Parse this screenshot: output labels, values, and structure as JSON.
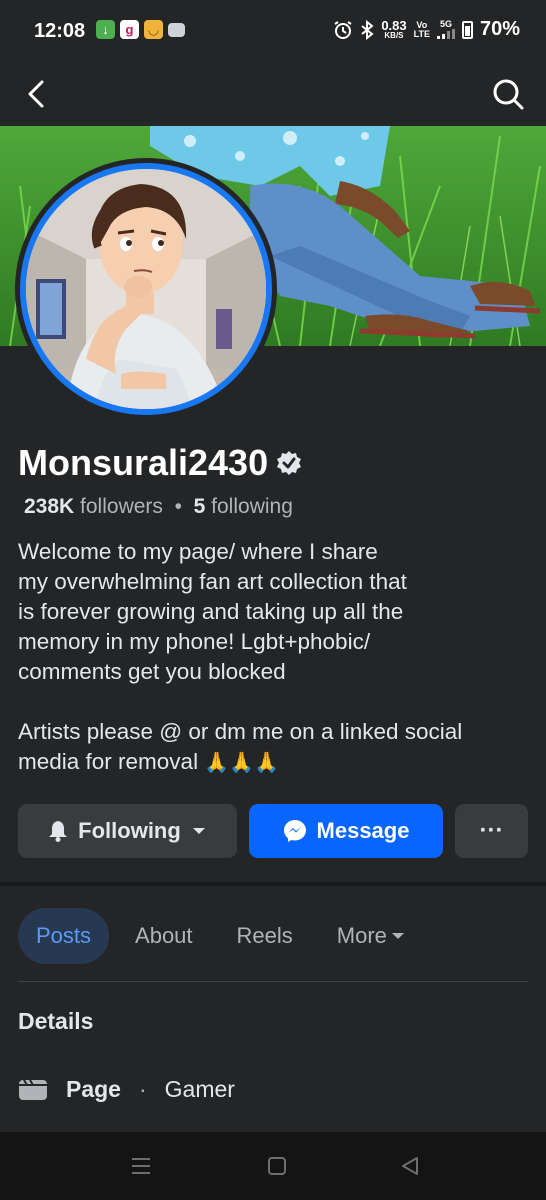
{
  "status_bar": {
    "time": "12:08",
    "net_speed": "0.83",
    "net_unit": "KB/S",
    "volte_top": "Vo",
    "volte_bottom": "LTE",
    "signal_label": "5G",
    "battery": "70%"
  },
  "profile": {
    "name": "Monsurali2430",
    "followers_count": "238K",
    "followers_label": "followers",
    "following_count": "5",
    "following_label": "following",
    "bio_line1": "Welcome to my page/ where I share\nmy overwhelming fan art collection that\nis forever growing and taking up all the\nmemory in my phone! Lgbt+phobic/\ncomments get you blocked\n\nArtists please @ or dm me on a linked social\nmedia for removal ",
    "bio_emoji": "🙏🙏🙏"
  },
  "actions": {
    "following_label": "Following",
    "message_label": "Message",
    "more_label": "···"
  },
  "tabs": [
    {
      "label": "Posts"
    },
    {
      "label": "About"
    },
    {
      "label": "Reels"
    },
    {
      "label": "More"
    }
  ],
  "details": {
    "title": "Details",
    "page_label": "Page",
    "separator": "·",
    "category": "Gamer"
  },
  "colors": {
    "background": "#242526",
    "accent_blue": "#0866ff",
    "active_tab_bg": "#263951",
    "active_tab_text": "#5a9bf6"
  }
}
